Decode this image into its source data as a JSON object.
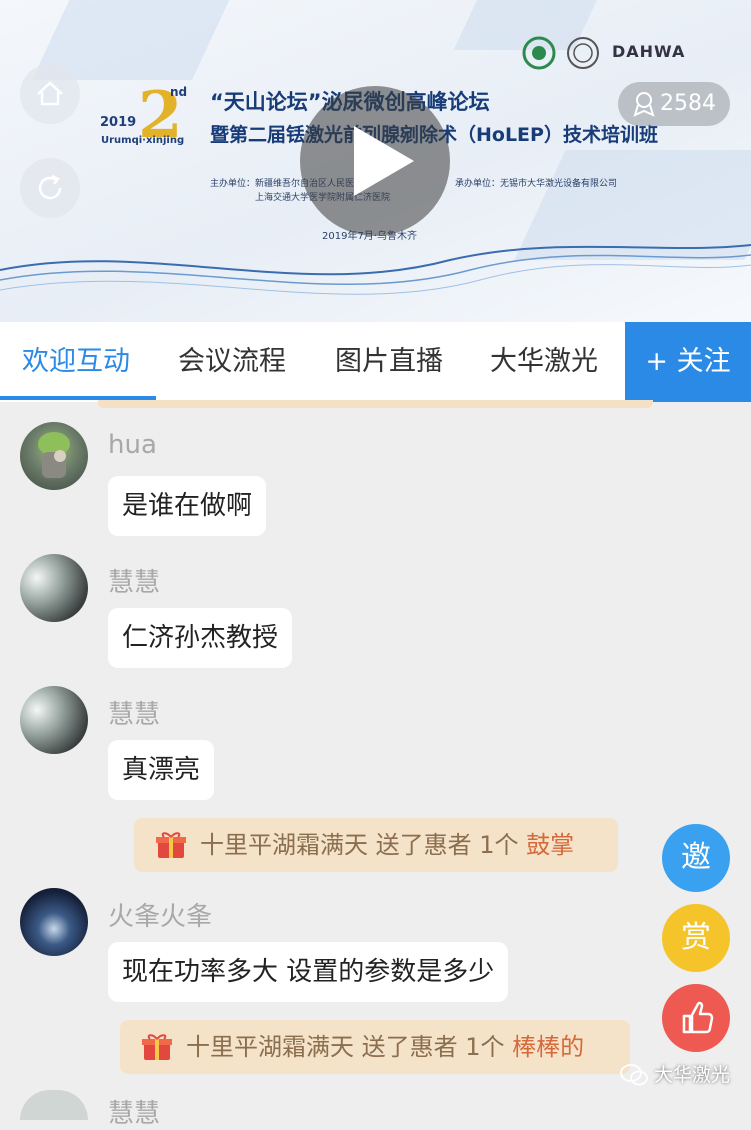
{
  "banner": {
    "year": "2019",
    "edition": "2",
    "edition_suffix": "nd",
    "city": "Urumqi·xinjing",
    "title_line1": "“天山论坛”泌尿微创高峰论坛",
    "title_line2": "暨第二届铥激光前列腺剜除术（HoLEP）技术培训班",
    "host_label": "主办单位：新疆维吾尔自治区人民医院",
    "host_label2": "上海交通大学医学院附属仁济医院",
    "co_label": "承办单位：无锡市大华激光设备有限公司",
    "date_text": "2019年7月·乌鲁木齐",
    "logo_text": "DAHWA",
    "view_count": "2584"
  },
  "tabs": [
    {
      "label": "欢迎互动"
    },
    {
      "label": "会议流程"
    },
    {
      "label": "图片直播"
    },
    {
      "label": "大华激光"
    }
  ],
  "follow_label": "+ 关注",
  "messages": [
    {
      "user": "hua",
      "text": "是谁在做啊"
    },
    {
      "user": "慧慧",
      "text": "仁济孙杰教授"
    },
    {
      "user": "慧慧",
      "text": "真漂亮"
    },
    {
      "user": "火夆火夆",
      "text": "现在功率多大 设置的参数是多少"
    }
  ],
  "gifts": [
    {
      "prefix": "十里平湖霜满天 送了惠者 1个 ",
      "gift": "鼓掌"
    },
    {
      "prefix": "十里平湖霜满天 送了惠者 1个 ",
      "gift": "棒棒的"
    }
  ],
  "partial_user": "慧慧",
  "side_buttons": {
    "invite": "邀",
    "reward": "赏"
  },
  "watermark": "大华激光",
  "colors": {
    "accent": "#2a8ae6",
    "invite": "#3aa0f0",
    "reward": "#f5c32a",
    "like": "#ee5a52",
    "gift_bg": "#f5e3c9"
  }
}
